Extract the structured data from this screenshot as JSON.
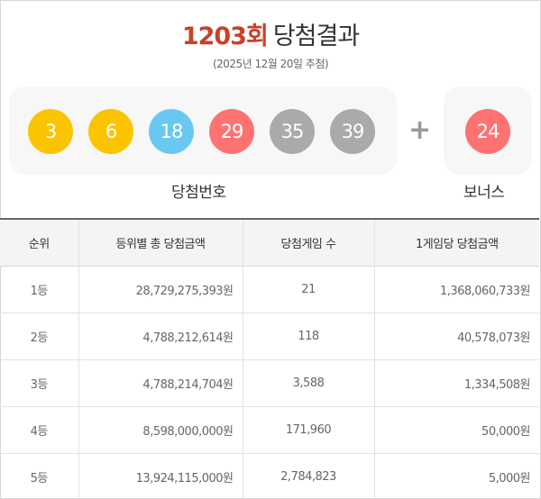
{
  "header": {
    "round": "1203회",
    "title": "당첨결과",
    "draw_date": "(2025년 12월 20일 추첨)"
  },
  "numbers": {
    "winning": [
      "3",
      "6",
      "18",
      "29",
      "35",
      "39"
    ],
    "bonus": "24",
    "plus": "+",
    "winning_label": "당첨번호",
    "bonus_label": "보너스"
  },
  "colors": {
    "ball_yellow": "#fbc400",
    "ball_blue": "#69c8f2",
    "ball_red": "#ff7272",
    "ball_gray": "#aaaaaa",
    "accent": "#c8402a"
  },
  "table": {
    "headers": [
      "순위",
      "등위별 총 당첨금액",
      "당첨게임 수",
      "1게임당 당첨금액"
    ],
    "rows": [
      {
        "rank": "1등",
        "total": "28,729,275,393원",
        "count": "21",
        "each": "1,368,060,733원"
      },
      {
        "rank": "2등",
        "total": "4,788,212,614원",
        "count": "118",
        "each": "40,578,073원"
      },
      {
        "rank": "3등",
        "total": "4,788,214,704원",
        "count": "3,588",
        "each": "1,334,508원"
      },
      {
        "rank": "4등",
        "total": "8,598,000,000원",
        "count": "171,960",
        "each": "50,000원"
      },
      {
        "rank": "5등",
        "total": "13,924,115,000원",
        "count": "2,784,823",
        "each": "5,000원"
      }
    ]
  }
}
